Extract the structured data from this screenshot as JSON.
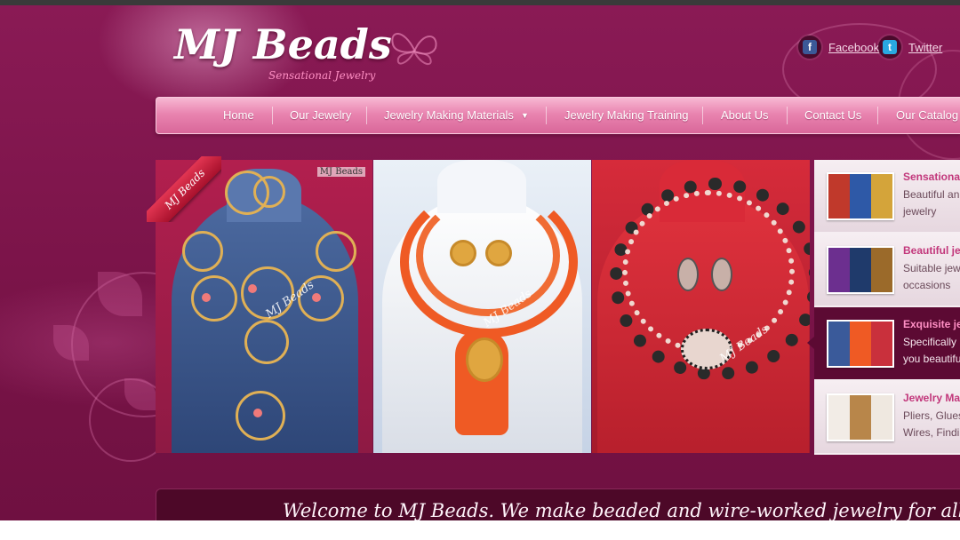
{
  "logo": {
    "title": "MJ Beads",
    "tagline": "Sensational Jewelry"
  },
  "social": {
    "facebook_label": "Facebook",
    "twitter_label": "Twitter"
  },
  "nav": {
    "items": [
      {
        "label": "Home"
      },
      {
        "label": "Our Jewelry"
      },
      {
        "label": "Jewelry Making Materials"
      },
      {
        "label": "Jewelry Making Training"
      },
      {
        "label": "About Us"
      },
      {
        "label": "Contact Us"
      },
      {
        "label": "Our Catalog"
      }
    ]
  },
  "slider": {
    "ribbon_label": "MJ Beads",
    "watermark": "MJ Beads",
    "brand_mini": "MJ Beads"
  },
  "thumbs": [
    {
      "title": "Sensational",
      "desc_line1": "Beautiful an",
      "desc_line2": "jewelry"
    },
    {
      "title": "Beautiful jew",
      "desc_line1": "Suitable jew",
      "desc_line2": "occasions"
    },
    {
      "title": "Exquisite jew",
      "desc_line1": "Specifically",
      "desc_line2": "you beautifu"
    },
    {
      "title": "Jewelry Mak",
      "desc_line1": "Pliers, Glues",
      "desc_line2": "Wires, Findi"
    }
  ],
  "welcome": {
    "text": "Welcome to MJ Beads. We make beaded and wire-worked jewelry for all occasions."
  },
  "colors": {
    "background": "#7a1448",
    "nav_pink": "#e984b0",
    "accent": "#c2377b"
  }
}
